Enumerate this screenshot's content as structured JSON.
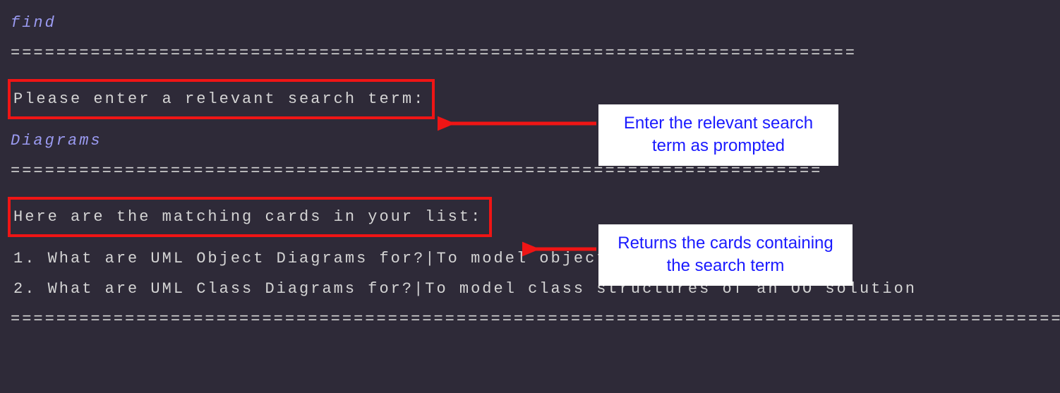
{
  "terminal": {
    "command": "find",
    "divider1": "==========================================================================",
    "prompt_line": "Please enter a relevant search term:",
    "user_input": "Diagrams",
    "divider2": "=======================================================================",
    "results_header": "Here are the matching cards in your list:",
    "results": [
      "1. What are UML Object Diagrams for?|To model object structures",
      "2. What are UML Class Diagrams for?|To model class structures of an OO solution"
    ],
    "divider3": "================================================================================================="
  },
  "annotations": {
    "callout1": "Enter the relevant search term as prompted",
    "callout2": "Returns the cards containing the search term"
  }
}
